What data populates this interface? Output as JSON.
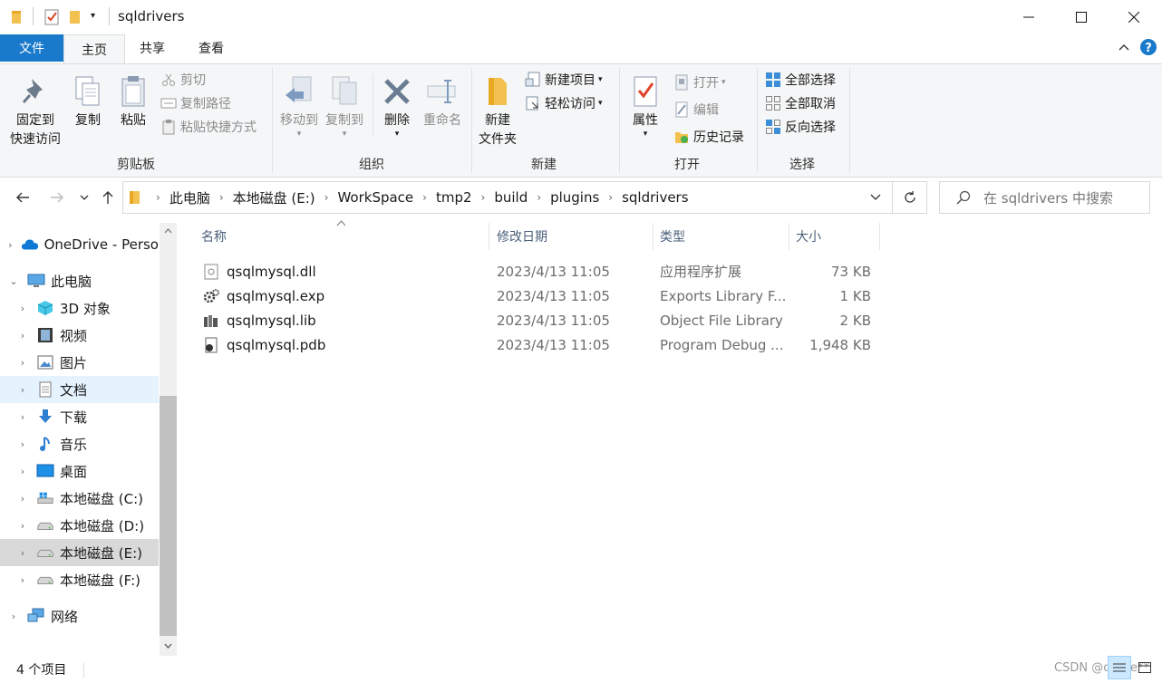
{
  "window": {
    "title": "sqldrivers"
  },
  "tabs": {
    "file": "文件",
    "home": "主页",
    "share": "共享",
    "view": "查看"
  },
  "ribbon": {
    "clipboard": {
      "label": "剪贴板",
      "pin_line1": "固定到",
      "pin_line2": "快速访问",
      "copy": "复制",
      "paste": "粘贴",
      "cut": "剪切",
      "copy_path": "复制路径",
      "paste_shortcut": "粘贴快捷方式"
    },
    "organize": {
      "label": "组织",
      "move_to": "移动到",
      "copy_to": "复制到",
      "delete": "删除",
      "rename": "重命名"
    },
    "new": {
      "label": "新建",
      "new_folder_line1": "新建",
      "new_folder_line2": "文件夹",
      "new_item": "新建项目",
      "easy_access": "轻松访问"
    },
    "open": {
      "label": "打开",
      "properties": "属性",
      "open": "打开",
      "edit": "编辑",
      "history": "历史记录"
    },
    "select": {
      "label": "选择",
      "select_all": "全部选择",
      "select_none": "全部取消",
      "invert": "反向选择"
    }
  },
  "address": {
    "crumbs": [
      "此电脑",
      "本地磁盘 (E:)",
      "WorkSpace",
      "tmp2",
      "build",
      "plugins",
      "sqldrivers"
    ],
    "search_placeholder": "在 sqldrivers 中搜索"
  },
  "nav": {
    "items": [
      {
        "label": "OneDrive - Perso",
        "icon": "onedrive-icon"
      },
      {
        "label": "此电脑",
        "icon": "computer-icon"
      },
      {
        "label": "3D 对象",
        "icon": "3d-objects-icon"
      },
      {
        "label": "视频",
        "icon": "video-icon"
      },
      {
        "label": "图片",
        "icon": "pictures-icon"
      },
      {
        "label": "文档",
        "icon": "documents-icon"
      },
      {
        "label": "下载",
        "icon": "download-icon"
      },
      {
        "label": "音乐",
        "icon": "music-icon"
      },
      {
        "label": "桌面",
        "icon": "desktop-icon"
      },
      {
        "label": "本地磁盘 (C:)",
        "icon": "drive-c-icon"
      },
      {
        "label": "本地磁盘 (D:)",
        "icon": "drive-icon"
      },
      {
        "label": "本地磁盘 (E:)",
        "icon": "drive-icon"
      },
      {
        "label": "本地磁盘 (F:)",
        "icon": "drive-icon"
      },
      {
        "label": "网络",
        "icon": "network-icon"
      }
    ]
  },
  "columns": {
    "name": "名称",
    "date": "修改日期",
    "type": "类型",
    "size": "大小"
  },
  "files": [
    {
      "name": "qsqlmysql.dll",
      "date": "2023/4/13 11:05",
      "type": "应用程序扩展",
      "size": "73 KB"
    },
    {
      "name": "qsqlmysql.exp",
      "date": "2023/4/13 11:05",
      "type": "Exports Library F...",
      "size": "1 KB"
    },
    {
      "name": "qsqlmysql.lib",
      "date": "2023/4/13 11:05",
      "type": "Object File Library",
      "size": "2 KB"
    },
    {
      "name": "qsqlmysql.pdb",
      "date": "2023/4/13 11:05",
      "type": "Program Debug ...",
      "size": "1,948 KB"
    }
  ],
  "status": {
    "count": "4 个项目"
  },
  "watermark": "CSDN @qasse**"
}
